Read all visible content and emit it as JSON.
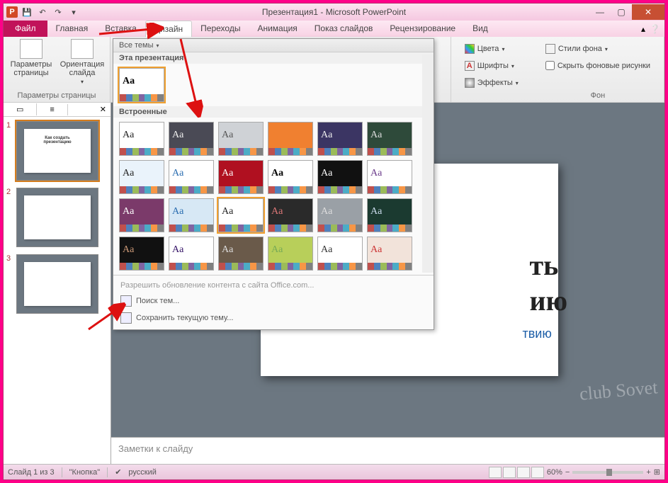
{
  "title": "Презентация1 - Microsoft PowerPoint",
  "qat": {
    "app_letter": "P"
  },
  "tabs": {
    "file": "Файл",
    "items": [
      "Главная",
      "Вставка",
      "Дизайн",
      "Переходы",
      "Анимация",
      "Показ слайдов",
      "Рецензирование",
      "Вид"
    ],
    "active_index": 2
  },
  "ribbon": {
    "page_setup": {
      "params": "Параметры\nстраницы",
      "orient": "Ориентация\nслайда",
      "group": "Параметры страницы"
    },
    "colors": "Цвета",
    "fonts": "Шрифты",
    "effects": "Эффекты",
    "bg_styles": "Стили фона",
    "hide_bg": "Скрыть фоновые рисунки",
    "bg_group": "Фон"
  },
  "themes_dd": {
    "all": "Все темы",
    "this_pres": "Эта презентация",
    "builtin": "Встроенные",
    "office_update": "Разрешить обновление контента с сайта Office.com...",
    "browse": "Поиск тем...",
    "save_theme": "Сохранить текущую тему...",
    "thumb_label": "Aa",
    "row1_bg": [
      "#ffffff",
      "#4a4a55",
      "#cfd2d6",
      "#f08030",
      "#3b3563",
      "#2e4a3a"
    ],
    "row1_fg": [
      "#222",
      "#eee",
      "#555",
      "#f08030",
      "#eee",
      "#ddd"
    ],
    "row2_bg": [
      "#eaf3fb",
      "#ffffff",
      "#b01020",
      "#ffffff",
      "#111111",
      "#ffffff"
    ],
    "row2_fg": [
      "#222",
      "#2a6db0",
      "#fff",
      "#000",
      "#fff",
      "#6a3a8a"
    ],
    "row3_bg": [
      "#7b3a6a",
      "#d7e8f5",
      "#ffffff",
      "#2a2a2a",
      "#9aa0a6",
      "#1b3a30"
    ],
    "row3_fg": [
      "#fff",
      "#2a6db0",
      "#222",
      "#d77",
      "#ddd",
      "#cde"
    ],
    "row4_bg": [
      "#111111",
      "#ffffff",
      "#6a5a4a",
      "#b8cf5a",
      "#ffffff",
      "#f2e3da"
    ],
    "row4_fg": [
      "#c97",
      "#316",
      "#ddd",
      "#7a5",
      "#333",
      "#c33"
    ],
    "bar_colors": [
      "#c0504d",
      "#4f81bd",
      "#9bbb59",
      "#8064a2",
      "#4bacc6",
      "#f79646",
      "#808080"
    ]
  },
  "slidepanel": {
    "tab1": "",
    "tab2": "",
    "slides": [
      {
        "num": "1",
        "title": "Как создать\nпрезентацию",
        "sub": ""
      },
      {
        "num": "2",
        "title": "",
        "sub": ""
      },
      {
        "num": "3",
        "title": "",
        "sub": ""
      }
    ]
  },
  "slide": {
    "title_frag1": "ть",
    "title_frag2": "ию",
    "subtitle_frag": "твию"
  },
  "notes_placeholder": "Заметки к слайду",
  "status": {
    "slide_of": "Слайд 1 из 3",
    "theme": "\"Кнопка\"",
    "lang": "русский",
    "zoom": "60%"
  },
  "watermark": "club Sovet"
}
